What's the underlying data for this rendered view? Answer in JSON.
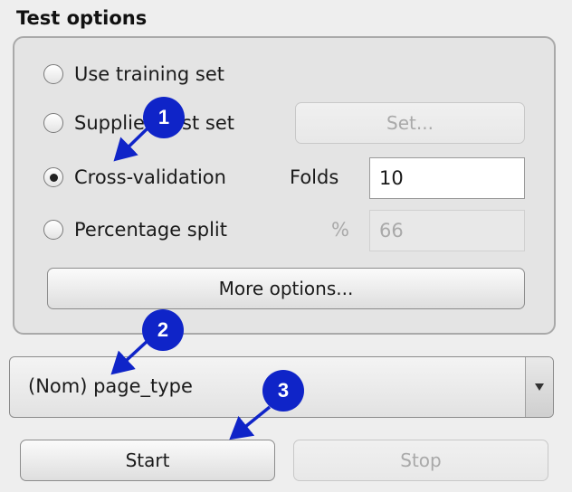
{
  "test_options": {
    "title": "Test options",
    "options": [
      {
        "label": "Use training set",
        "selected": false
      },
      {
        "label": "Supplied test set",
        "selected": false
      },
      {
        "label": "Cross-validation",
        "selected": true
      },
      {
        "label": "Percentage split",
        "selected": false
      }
    ],
    "set_button": "Set...",
    "folds_label": "Folds",
    "folds_value": "10",
    "percent_symbol": "%",
    "percent_value": "66",
    "more_options_button": "More options..."
  },
  "class_selector": {
    "value": "(Nom) page_type",
    "icon": "chevron-down-icon"
  },
  "actions": {
    "start": "Start",
    "stop": "Stop"
  },
  "annotations": [
    {
      "number": "1"
    },
    {
      "number": "2"
    },
    {
      "number": "3"
    }
  ],
  "colors": {
    "marker": "#0f24c8",
    "background": "#eeeeee"
  }
}
